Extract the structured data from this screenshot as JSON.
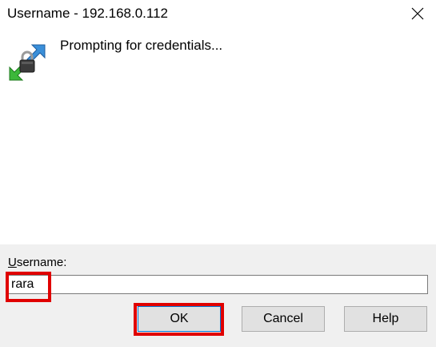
{
  "window": {
    "title": "Username - 192.168.0.112",
    "close_icon": "close-icon"
  },
  "status": {
    "icon": "credentials-transfer-icon",
    "message": "Prompting for credentials..."
  },
  "form": {
    "label_mnemonic": "U",
    "label_rest": "sername:",
    "username_value": "rara"
  },
  "buttons": {
    "ok_label": "OK",
    "cancel_label": "Cancel",
    "help_label": "Help"
  },
  "colors": {
    "highlight": "#e00000",
    "panel_background": "#f0f0f0",
    "accent": "#0078d7"
  }
}
